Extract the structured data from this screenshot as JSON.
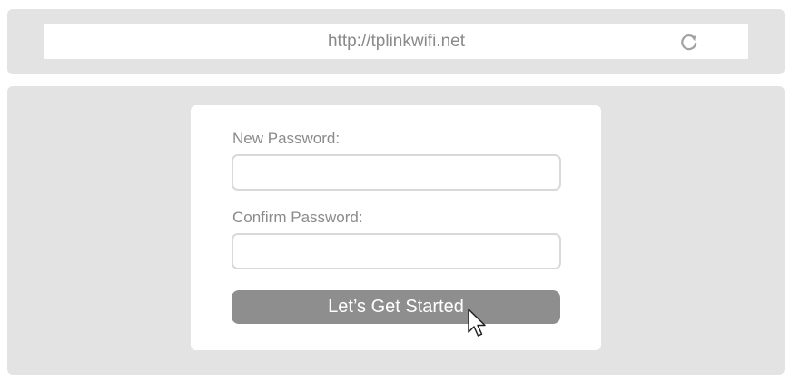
{
  "browser": {
    "url": "http://tplinkwifi.net",
    "reload_icon": "reload-icon"
  },
  "form": {
    "new_password_label": "New Password:",
    "new_password_value": "",
    "confirm_password_label": "Confirm Password:",
    "confirm_password_value": "",
    "submit_label": "Let’s Get Started"
  },
  "pointer": {
    "icon": "mouse-cursor-icon"
  },
  "colors": {
    "panel_background": "#e3e3e3",
    "card_background": "#ffffff",
    "button_background": "#8e8e8e",
    "label_text": "#8b8b8b",
    "input_border": "#d9d9d9"
  }
}
